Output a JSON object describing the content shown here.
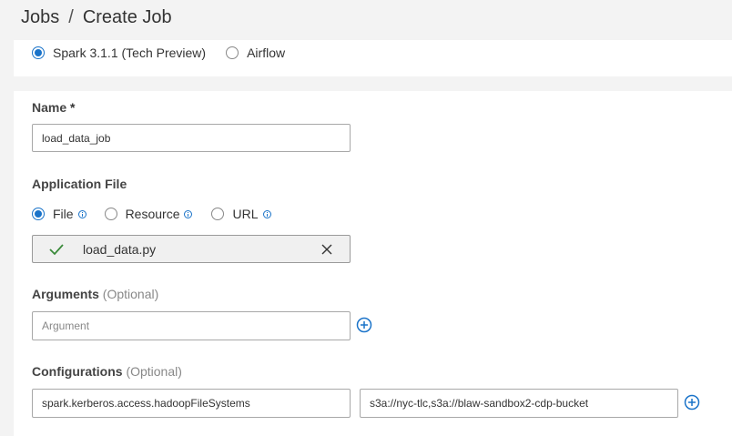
{
  "breadcrumb": {
    "root": "Jobs",
    "separator": "/",
    "current": "Create Job"
  },
  "job_type": {
    "options": [
      {
        "label": "Spark 3.1.1 (Tech Preview)",
        "selected": true
      },
      {
        "label": "Airflow",
        "selected": false
      }
    ]
  },
  "name": {
    "label": "Name",
    "required_mark": "*",
    "value": "load_data_job"
  },
  "application_file": {
    "label": "Application File",
    "options": [
      {
        "label": "File",
        "selected": true
      },
      {
        "label": "Resource",
        "selected": false
      },
      {
        "label": "URL",
        "selected": false
      }
    ],
    "file_name": "load_data.py"
  },
  "arguments": {
    "label": "Arguments",
    "optional": "(Optional)",
    "placeholder": "Argument"
  },
  "configurations": {
    "label": "Configurations",
    "optional": "(Optional)",
    "key": "spark.kerberos.access.hadoopFileSystems",
    "value": "s3a://nyc-tlc,s3a://blaw-sandbox2-cdp-bucket"
  },
  "colors": {
    "accent": "#1a73c9",
    "success": "#3a8a3a"
  },
  "icons": [
    "info-icon",
    "check-icon",
    "close-icon",
    "plus-circle-icon"
  ]
}
